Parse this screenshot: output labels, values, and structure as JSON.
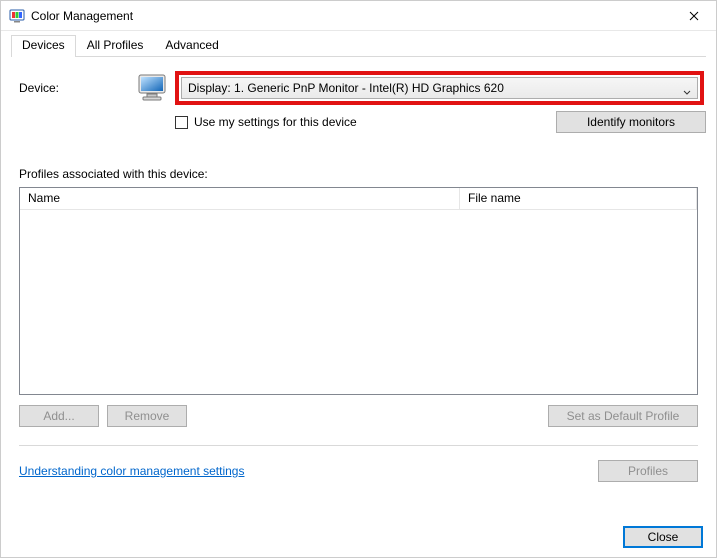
{
  "window": {
    "title": "Color Management"
  },
  "tabs": {
    "devices": "Devices",
    "all": "All Profiles",
    "advanced": "Advanced"
  },
  "device": {
    "label": "Device:",
    "selected": "Display: 1. Generic PnP Monitor - Intel(R) HD Graphics 620",
    "use_my_settings": "Use my settings for this device",
    "identify": "Identify monitors"
  },
  "profiles": {
    "heading": "Profiles associated with this device:",
    "col_name": "Name",
    "col_file": "File name"
  },
  "buttons": {
    "add": "Add...",
    "remove": "Remove",
    "set_default": "Set as Default Profile",
    "profiles": "Profiles",
    "close": "Close"
  },
  "link": {
    "understand": "Understanding color management settings"
  }
}
